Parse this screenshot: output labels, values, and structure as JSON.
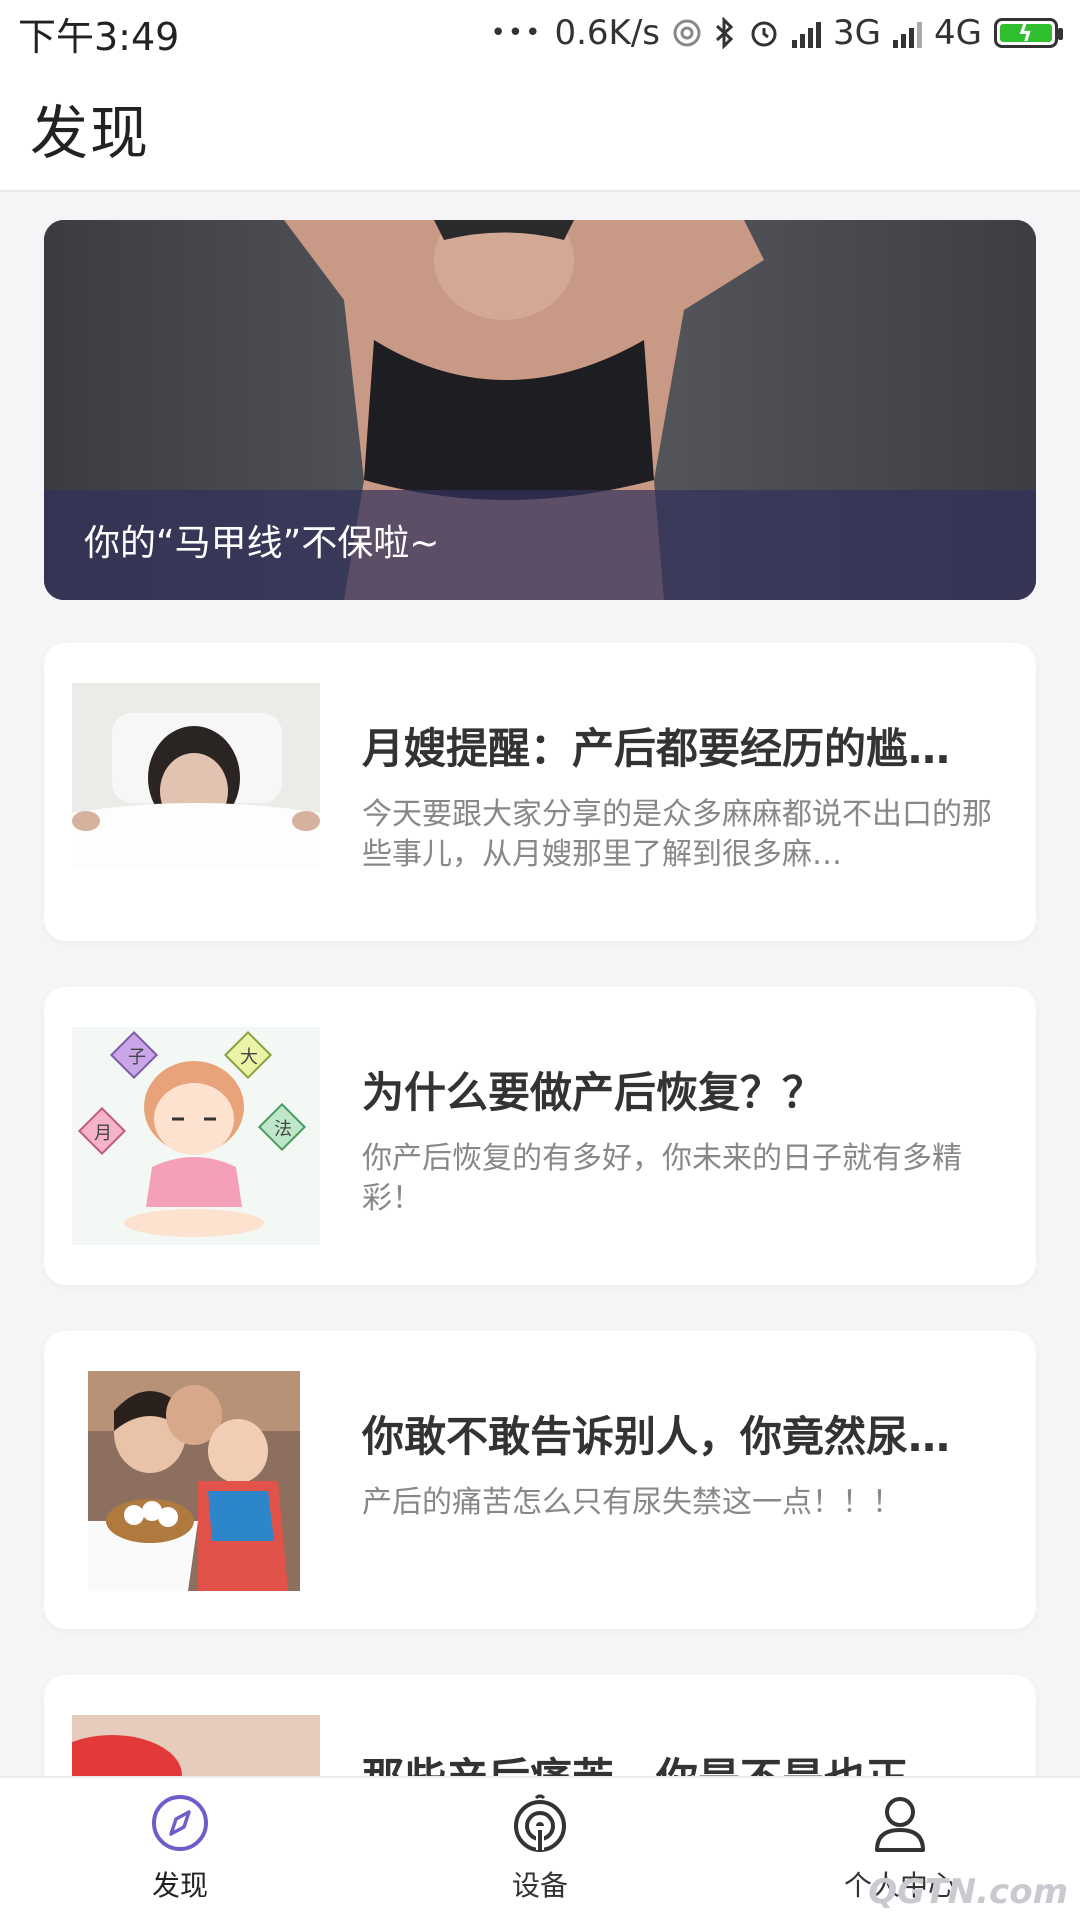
{
  "status_bar": {
    "time": "下午3:49",
    "dots": "•••",
    "net_speed": "0.6K/s",
    "net_3g": "3G",
    "net_4g": "4G"
  },
  "header": {
    "title": "发现"
  },
  "banner": {
    "caption": "你的“马甲线”不保啦~"
  },
  "articles": [
    {
      "title": "月嫂提醒：产后都要经历的尴…",
      "desc": "今天要跟大家分享的是众多麻麻都说不出口的那些事儿，从月嫂那里了解到很多麻…"
    },
    {
      "title": "为什么要做产后恢复？？",
      "desc": "你产后恢复的有多好，你未来的日子就有多精彩！"
    },
    {
      "title": "你敢不敢告诉别人，你竟然尿…",
      "desc": "产后的痛苦怎么只有尿失禁这一点！！！"
    },
    {
      "title": "那些产后痛苦，你是不是也正",
      "desc": ""
    }
  ],
  "thumb_badges": [
    "子",
    "大",
    "月",
    "法"
  ],
  "bottom_nav": {
    "items": [
      {
        "label": "发现",
        "icon": "compass-icon"
      },
      {
        "label": "设备",
        "icon": "device-icon"
      },
      {
        "label": "个人中心",
        "icon": "user-icon"
      }
    ]
  },
  "watermark": "QGTN.com",
  "colors": {
    "accent": "#6c5fc9",
    "banner_overlay": "#32305c",
    "battery": "#2fbf2f"
  }
}
